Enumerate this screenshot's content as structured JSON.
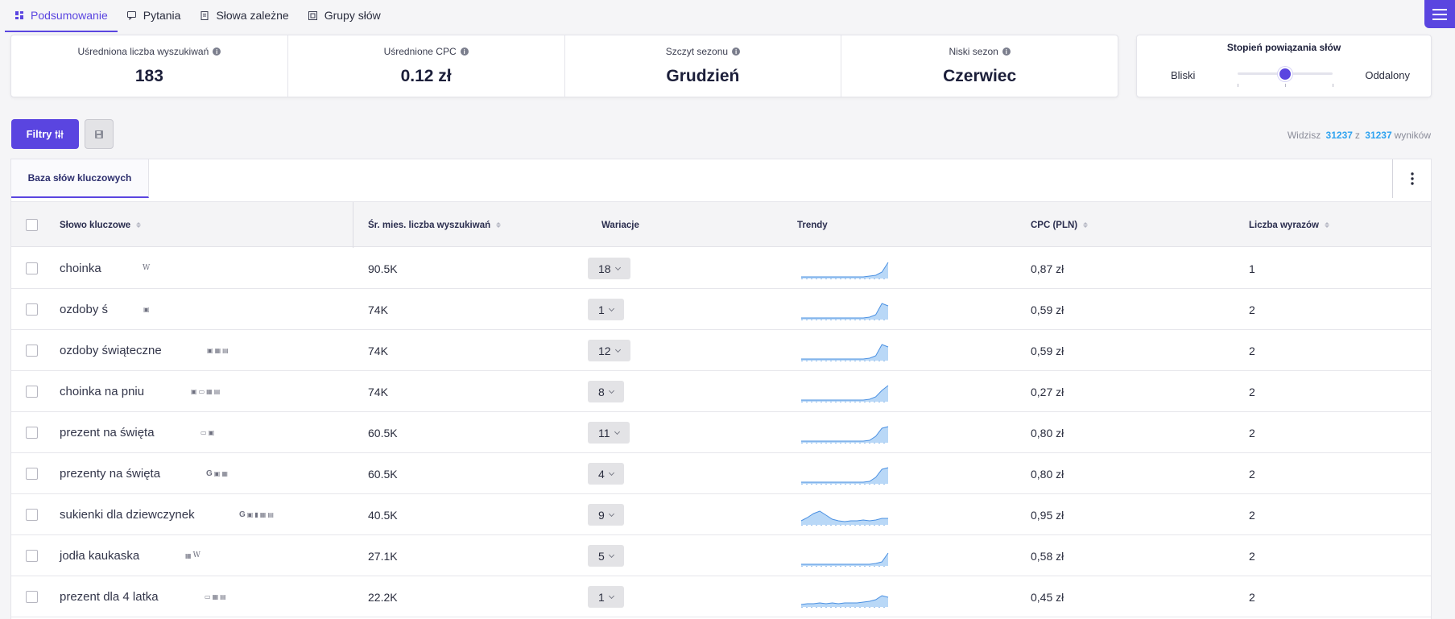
{
  "nav": {
    "tabs": [
      {
        "label": "Podsumowanie",
        "icon": "dashboard-icon",
        "active": true
      },
      {
        "label": "Pytania",
        "icon": "chat-icon",
        "active": false
      },
      {
        "label": "Słowa zależne",
        "icon": "document-icon",
        "active": false
      },
      {
        "label": "Grupy słów",
        "icon": "group-icon",
        "active": false
      }
    ]
  },
  "stats": [
    {
      "label": "Uśredniona liczba wyszukiwań",
      "value": "183"
    },
    {
      "label": "Uśrednione CPC",
      "value": "0.12 zł"
    },
    {
      "label": "Szczyt sezonu",
      "value": "Grudzień"
    },
    {
      "label": "Niski sezon",
      "value": "Czerwiec"
    }
  ],
  "relation": {
    "title": "Stopień powiązania słów",
    "left_label": "Bliski",
    "right_label": "Oddalony",
    "level": 0.5
  },
  "toolbar": {
    "filters_label": "Filtry",
    "results_prefix": "Widzisz",
    "results_shown": "31237",
    "results_mid": "z",
    "results_total": "31237",
    "results_suffix": "wyników"
  },
  "panel": {
    "tab_label": "Baza słów kluczowych"
  },
  "table": {
    "headers": {
      "keyword": "Słowo kluczowe",
      "volume": "Śr. mies. liczba wyszukiwań",
      "variations": "Wariacje",
      "trends": "Trendy",
      "cpc": "CPC (PLN)",
      "words": "Liczba wyrazów"
    },
    "rows": [
      {
        "keyword": "choinka",
        "icons": [
          "W"
        ],
        "volume": "90.5K",
        "variations": "18",
        "cpc": "0,87 zł",
        "words": "1",
        "trend": [
          2,
          2,
          2,
          2,
          2,
          2,
          2,
          2,
          2,
          2,
          2,
          3,
          4,
          8,
          20
        ]
      },
      {
        "keyword": "ozdoby ś",
        "icons": [
          "▣"
        ],
        "volume": "74K",
        "variations": "1",
        "cpc": "0,59 zł",
        "words": "2",
        "trend": [
          2,
          2,
          2,
          2,
          2,
          2,
          2,
          2,
          2,
          2,
          2,
          3,
          6,
          20,
          17
        ]
      },
      {
        "keyword": "ozdoby świąteczne",
        "icons": [
          "▣",
          "▦",
          "▤"
        ],
        "volume": "74K",
        "variations": "12",
        "cpc": "0,59 zł",
        "words": "2",
        "trend": [
          2,
          2,
          2,
          2,
          2,
          2,
          2,
          2,
          2,
          2,
          2,
          3,
          6,
          20,
          17
        ]
      },
      {
        "keyword": "choinka na pniu",
        "icons": [
          "▣",
          "▭",
          "▦",
          "▤"
        ],
        "volume": "74K",
        "variations": "8",
        "cpc": "0,27 zł",
        "words": "2",
        "trend": [
          2,
          2,
          2,
          2,
          2,
          2,
          2,
          2,
          2,
          2,
          2,
          3,
          6,
          14,
          20
        ]
      },
      {
        "keyword": "prezent na święta",
        "icons": [
          "▭",
          "▣"
        ],
        "volume": "60.5K",
        "variations": "11",
        "cpc": "0,80 zł",
        "words": "2",
        "trend": [
          2,
          2,
          2,
          2,
          2,
          2,
          2,
          2,
          2,
          2,
          2,
          3,
          8,
          18,
          20
        ]
      },
      {
        "keyword": "prezenty na święta",
        "icons": [
          "G",
          "▣",
          "▦"
        ],
        "volume": "60.5K",
        "variations": "4",
        "cpc": "0,80 zł",
        "words": "2",
        "trend": [
          2,
          2,
          2,
          2,
          2,
          2,
          2,
          2,
          2,
          2,
          2,
          3,
          8,
          18,
          20
        ]
      },
      {
        "keyword": "sukienki dla dziewczynek",
        "icons": [
          "G",
          "▣",
          "▮",
          "▦",
          "▤"
        ],
        "volume": "40.5K",
        "variations": "9",
        "cpc": "0,95 zł",
        "words": "2",
        "trend": [
          5,
          9,
          14,
          17,
          12,
          7,
          5,
          4,
          5,
          5,
          6,
          5,
          6,
          8,
          8
        ]
      },
      {
        "keyword": "jodła kaukaska",
        "icons": [
          "▦",
          "W"
        ],
        "volume": "27.1K",
        "variations": "5",
        "cpc": "0,58 zł",
        "words": "2",
        "trend": [
          2,
          2,
          2,
          2,
          2,
          2,
          2,
          2,
          2,
          2,
          2,
          2,
          3,
          5,
          16
        ]
      },
      {
        "keyword": "prezent dla 4 latka",
        "icons": [
          "▭",
          "▦",
          "▤"
        ],
        "volume": "22.2K",
        "variations": "1",
        "cpc": "0,45 zł",
        "words": "2",
        "trend": [
          3,
          4,
          4,
          5,
          4,
          5,
          4,
          5,
          5,
          5,
          6,
          7,
          9,
          14,
          12
        ]
      }
    ]
  },
  "colors": {
    "accent": "#5a45e0",
    "link": "#2fa3f0",
    "trend_fill": "#b9d8f7",
    "trend_line": "#4a90e2"
  }
}
